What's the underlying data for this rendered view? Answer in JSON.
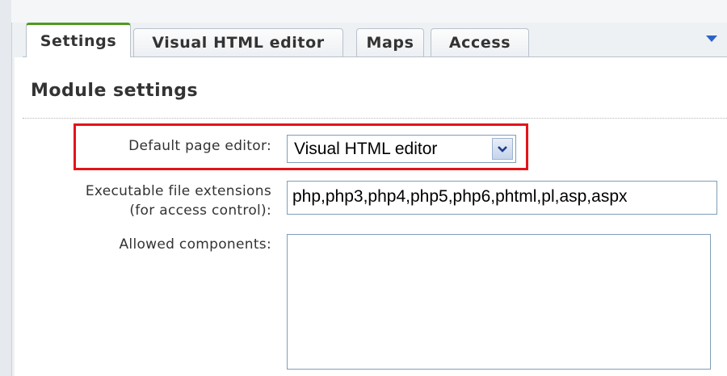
{
  "tabs": [
    {
      "label": "Settings",
      "active": true
    },
    {
      "label": "Visual HTML editor",
      "active": false
    },
    {
      "label": "Maps",
      "active": false
    },
    {
      "label": "Access",
      "active": false
    }
  ],
  "section": {
    "title": "Module settings"
  },
  "form": {
    "default_editor": {
      "label": "Default page editor:",
      "value": "Visual HTML editor"
    },
    "extensions": {
      "label_line1": "Executable file extensions",
      "label_line2": "(for access control):",
      "value": "php,php3,php4,php5,php6,phtml,pl,asp,aspx"
    },
    "allowed_components": {
      "label": "Allowed components:",
      "value": ""
    }
  },
  "colors": {
    "highlight": "#e3141a",
    "active_tab_accent": "#4e9a1e",
    "menu_arrow": "#2b64c8"
  }
}
